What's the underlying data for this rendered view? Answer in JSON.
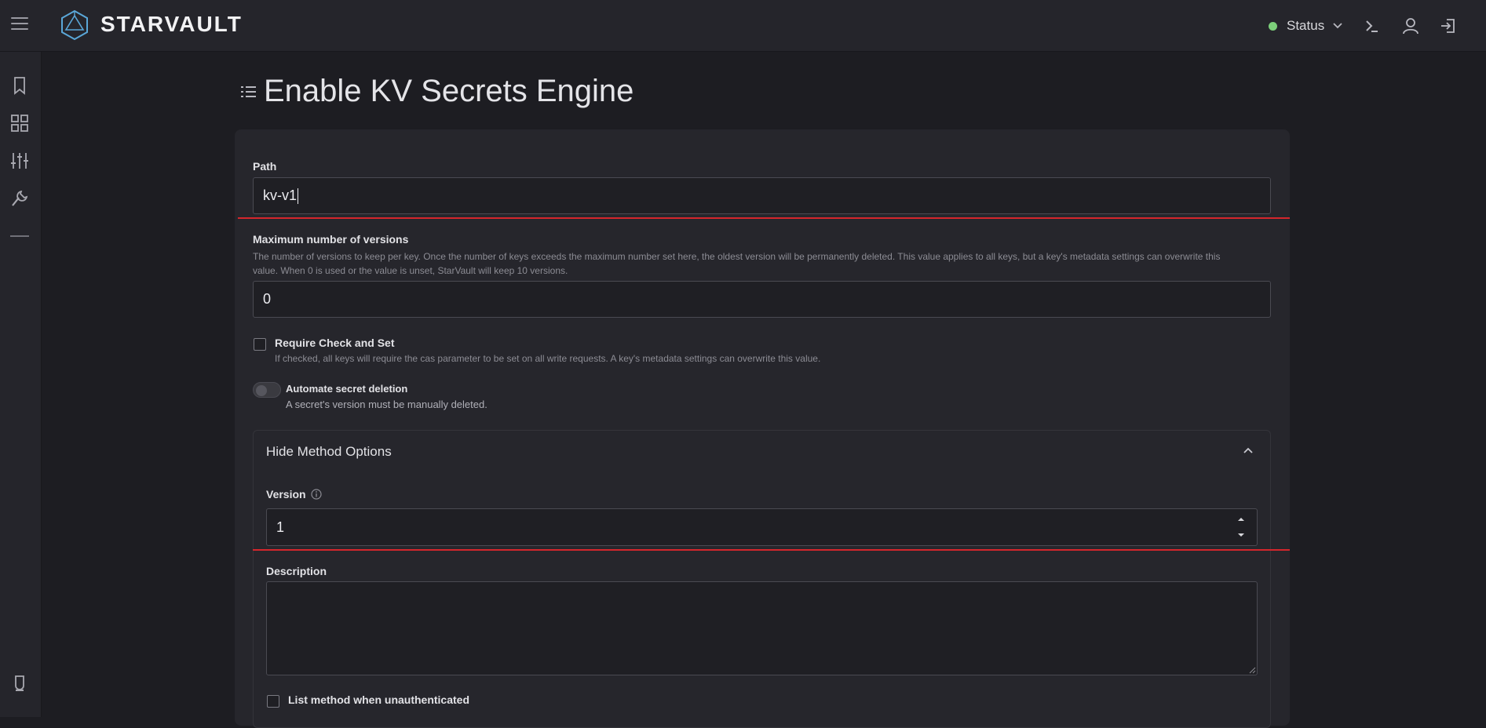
{
  "header": {
    "app_name": "STARVAULT",
    "status_label": "Status",
    "status_color": "#7ccf7a",
    "icons": [
      "menu-icon",
      "logo-icon",
      "chevron-down-icon",
      "terminal-icon",
      "user-icon",
      "sign-out-icon"
    ]
  },
  "sidebar": {
    "icons": [
      "bookmark-icon",
      "dashboard-grid-icon",
      "sliders-icon",
      "tools-icon",
      "collapse-dash-icon",
      "lightbulb-icon"
    ]
  },
  "page": {
    "title": "Enable KV Secrets Engine"
  },
  "form": {
    "path": {
      "label": "Path",
      "value": "kv-v1"
    },
    "max_versions": {
      "label": "Maximum number of versions",
      "help_line1": "The number of versions to keep per key. Once the number of keys exceeds the maximum number set here, the oldest version will be permanently deleted. This value applies to all keys, but a key's metadata settings can overwrite this",
      "help_line2": "value. When 0 is used or the value is unset, StarVault will keep 10 versions.",
      "value": "0"
    },
    "cas": {
      "label": "Require Check and Set",
      "help": "If checked, all keys will require the cas parameter to be set on all write requests. A key's metadata settings can overwrite this value.",
      "checked": false
    },
    "auto_delete": {
      "label": "Automate secret deletion",
      "help": "A secret's version must be manually deleted.",
      "enabled": false
    },
    "method_options": {
      "toggle_label": "Hide Method Options",
      "version": {
        "label": "Version",
        "value": "1"
      },
      "description": {
        "label": "Description",
        "value": ""
      },
      "list_unauth": {
        "label": "List method when unauthenticated",
        "checked": false
      }
    }
  },
  "colors": {
    "accent_error": "#d4262c",
    "background": "#1d1d22",
    "card": "#26262c"
  }
}
